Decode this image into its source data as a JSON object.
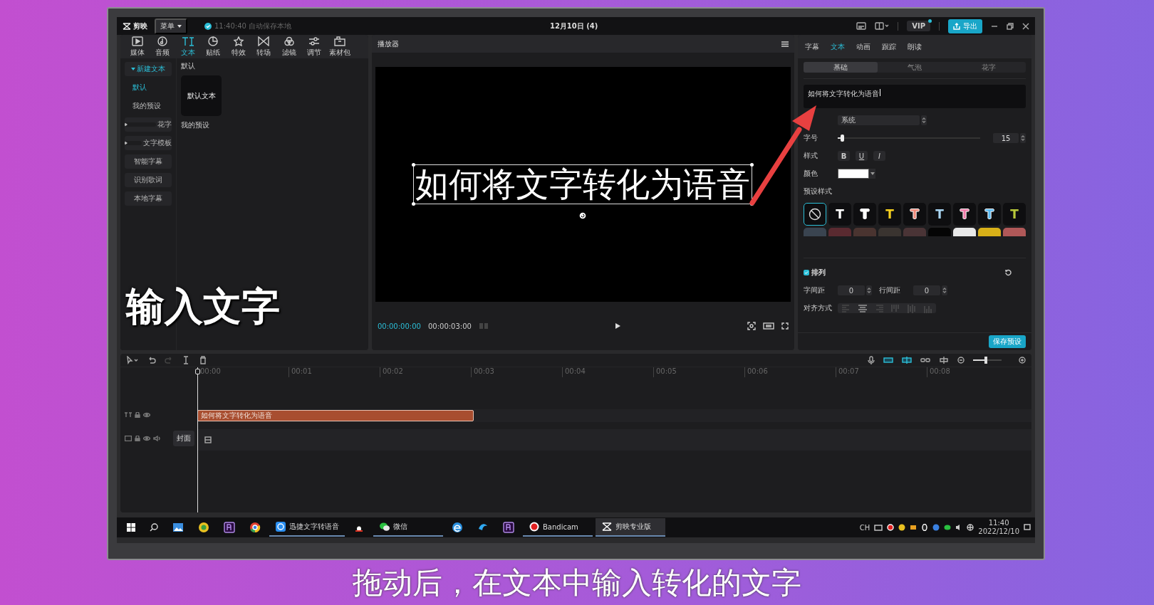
{
  "titlebar": {
    "app_name": "剪映",
    "menu": "菜单",
    "save_status": "11:40:40 自动保存本地",
    "project_title": "12月10日 (4)",
    "vip": "VIP",
    "export": "导出"
  },
  "toolbar": [
    {
      "label": "媒体",
      "kind": "media",
      "selected": false
    },
    {
      "label": "音频",
      "kind": "audio",
      "selected": false
    },
    {
      "label": "文本",
      "kind": "text",
      "selected": true
    },
    {
      "label": "贴纸",
      "kind": "sticker",
      "selected": false
    },
    {
      "label": "特效",
      "kind": "effect",
      "selected": false
    },
    {
      "label": "转场",
      "kind": "transition",
      "selected": false
    },
    {
      "label": "滤镜",
      "kind": "filter",
      "selected": false
    },
    {
      "label": "调节",
      "kind": "adjust",
      "selected": false
    },
    {
      "label": "素材包",
      "kind": "package",
      "selected": false
    }
  ],
  "left_nav": [
    {
      "label": "新建文本",
      "kind": "group",
      "expanded": true,
      "selected": true
    },
    {
      "label": "默认",
      "kind": "sub",
      "selected": true
    },
    {
      "label": "我的预设",
      "kind": "sub",
      "selected": false
    },
    {
      "label": "花字",
      "kind": "group",
      "expanded": false,
      "selected": false
    },
    {
      "label": "文字模板",
      "kind": "group",
      "expanded": false,
      "selected": false
    },
    {
      "label": "智能字幕",
      "kind": "button",
      "selected": false
    },
    {
      "label": "识别歌词",
      "kind": "button",
      "selected": false
    },
    {
      "label": "本地字幕",
      "kind": "button",
      "selected": false
    }
  ],
  "library": [
    {
      "title": "默认",
      "cards": [
        {
          "label": "默认文本"
        }
      ]
    },
    {
      "title": "我的预设"
    }
  ],
  "player": {
    "title": "播放器",
    "caption": "如何将文字转化为语音",
    "current_time": "00:00:00:00",
    "duration": "00:00:03:00"
  },
  "inspector": {
    "tabs": [
      {
        "label": "字幕",
        "selected": false
      },
      {
        "label": "文本",
        "selected": true
      },
      {
        "label": "动画",
        "selected": false
      },
      {
        "label": "跟踪",
        "selected": false
      },
      {
        "label": "朗读",
        "selected": false
      }
    ],
    "subtabs": [
      {
        "label": "基础",
        "selected": true
      },
      {
        "label": "气泡",
        "selected": false
      },
      {
        "label": "花字",
        "selected": false
      }
    ],
    "text_value": "如何将文字转化为语音",
    "font": "系统",
    "size": {
      "label": "字号",
      "level": 0.03,
      "value": "15"
    },
    "style_label": "样式",
    "styles": [
      "B",
      "U",
      "I"
    ],
    "color_label": "颜色",
    "color": "#ffffff",
    "presets_label": "预设样式",
    "presets": [
      {
        "kind": "none",
        "selected": true
      },
      {
        "kind": "style",
        "label": "T",
        "color": "#ffffff",
        "selected": false
      },
      {
        "kind": "outline",
        "label": "T",
        "color": "#ffffff",
        "selected": false
      },
      {
        "kind": "style",
        "label": "T",
        "color": "#f5d020",
        "selected": false
      },
      {
        "kind": "outline",
        "label": "T",
        "color": "#f08a7a",
        "selected": false
      },
      {
        "kind": "style",
        "label": "T",
        "color": "#a8d4f0",
        "selected": false
      },
      {
        "kind": "outline",
        "label": "T",
        "color": "#f07aa8",
        "selected": false
      },
      {
        "kind": "outline",
        "label": "T",
        "color": "#58b8f0",
        "selected": false
      },
      {
        "kind": "style",
        "label": "T",
        "color": "#b8c83a",
        "selected": false
      }
    ],
    "presets_more": [
      {
        "color": "#3a4450"
      },
      {
        "color": "#5a2a30"
      },
      {
        "color": "#4a3430"
      },
      {
        "color": "#3a3430"
      },
      {
        "color": "#4a3436"
      },
      {
        "color": "#050505"
      },
      {
        "color": "#e8e8e8"
      },
      {
        "color": "#d8b018"
      },
      {
        "color": "#b05858"
      }
    ],
    "arrange": {
      "label": "排列",
      "checked": true
    },
    "letter_spacing": {
      "label": "字间距",
      "value": "0"
    },
    "line_spacing": {
      "label": "行间距",
      "value": "0"
    },
    "align_label": "对齐方式",
    "align": [
      {
        "kind": "left",
        "selected": false
      },
      {
        "kind": "center",
        "selected": true
      },
      {
        "kind": "right",
        "selected": false
      },
      {
        "kind": "top",
        "selected": false
      },
      {
        "kind": "middle",
        "selected": false
      },
      {
        "kind": "bottom",
        "selected": false
      }
    ],
    "save": "保存预设"
  },
  "timeline": {
    "ticks": [
      "00:00",
      "00:01",
      "00:02",
      "00:03",
      "00:04",
      "00:05",
      "00:06",
      "00:07",
      "00:08"
    ],
    "clip": "如何将文字转化为语音",
    "cover": "封面",
    "zoom": {
      "level": 0.45
    }
  },
  "taskbar": {
    "apps": [
      {
        "kind": "photos",
        "selected": false
      },
      {
        "kind": "ball",
        "selected": false
      },
      {
        "kind": "pr",
        "selected": false
      },
      {
        "kind": "chrome",
        "selected": false
      },
      {
        "kind": "xunjie",
        "label": "迅捷文字转语音",
        "selected": false
      },
      {
        "kind": "penguin",
        "selected": false
      },
      {
        "kind": "wechat",
        "label": "微信",
        "selected": false
      },
      {
        "kind": "edge",
        "selected": false
      },
      {
        "kind": "wave",
        "selected": false
      },
      {
        "kind": "pr",
        "selected": false
      },
      {
        "kind": "record",
        "label": "Bandicam",
        "selected": false
      },
      {
        "kind": "capcut",
        "label": "剪映专业版",
        "selected": true
      }
    ],
    "lang": "CH",
    "time": "11:40",
    "date": "2022/12/10"
  },
  "callout": "输入文字",
  "subtitle": "拖动后，在文本中输入转化的文字"
}
